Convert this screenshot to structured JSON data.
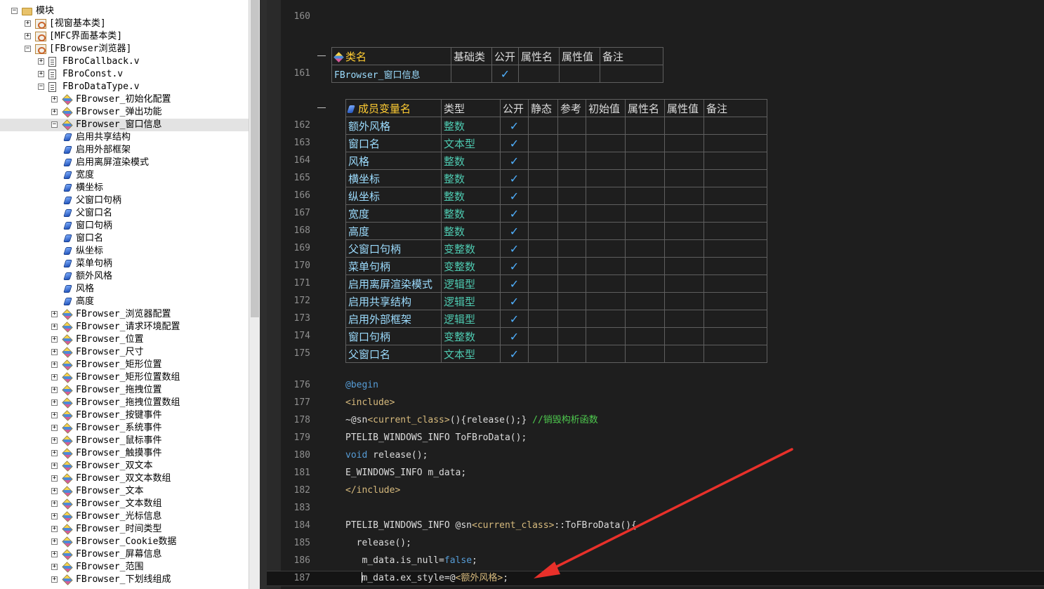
{
  "tree": {
    "items": [
      {
        "level": 0,
        "toggle": "−",
        "icon": "folder-icon",
        "label": "模块"
      },
      {
        "level": 1,
        "toggle": "+",
        "icon": "module-icon",
        "label": "[视窗基本类]"
      },
      {
        "level": 1,
        "toggle": "+",
        "icon": "module-icon",
        "label": "[MFC界面基本类]"
      },
      {
        "level": 1,
        "toggle": "−",
        "icon": "module-icon",
        "label": "[FBrowser浏览器]"
      },
      {
        "level": 2,
        "toggle": "+",
        "icon": "file-icon",
        "label": "FBroCallback.v"
      },
      {
        "level": 2,
        "toggle": "+",
        "icon": "file-icon",
        "label": "FBroConst.v"
      },
      {
        "level": 2,
        "toggle": "−",
        "icon": "file-icon",
        "label": "FBroDataType.v"
      },
      {
        "level": 3,
        "toggle": "+",
        "icon": "class-icon",
        "label": "FBrowser_初始化配置"
      },
      {
        "level": 3,
        "toggle": "+",
        "icon": "class-icon",
        "label": "FBrowser_弹出功能"
      },
      {
        "level": 3,
        "toggle": "−",
        "icon": "class-icon",
        "label": "FBrowser_窗口信息",
        "selected": true
      },
      {
        "level": 4,
        "toggle": "",
        "icon": "member-icon",
        "label": "启用共享结构"
      },
      {
        "level": 4,
        "toggle": "",
        "icon": "member-icon",
        "label": "启用外部框架"
      },
      {
        "level": 4,
        "toggle": "",
        "icon": "member-icon",
        "label": "启用离屏渲染模式"
      },
      {
        "level": 4,
        "toggle": "",
        "icon": "member-icon",
        "label": "宽度"
      },
      {
        "level": 4,
        "toggle": "",
        "icon": "member-icon",
        "label": "横坐标"
      },
      {
        "level": 4,
        "toggle": "",
        "icon": "member-icon",
        "label": "父窗口句柄"
      },
      {
        "level": 4,
        "toggle": "",
        "icon": "member-icon",
        "label": "父窗口名"
      },
      {
        "level": 4,
        "toggle": "",
        "icon": "member-icon",
        "label": "窗口句柄"
      },
      {
        "level": 4,
        "toggle": "",
        "icon": "member-icon",
        "label": "窗口名"
      },
      {
        "level": 4,
        "toggle": "",
        "icon": "member-icon",
        "label": "纵坐标"
      },
      {
        "level": 4,
        "toggle": "",
        "icon": "member-icon",
        "label": "菜单句柄"
      },
      {
        "level": 4,
        "toggle": "",
        "icon": "member-icon",
        "label": "额外风格"
      },
      {
        "level": 4,
        "toggle": "",
        "icon": "member-icon",
        "label": "风格"
      },
      {
        "level": 4,
        "toggle": "",
        "icon": "member-icon",
        "label": "高度"
      },
      {
        "level": 3,
        "toggle": "+",
        "icon": "class-icon",
        "label": "FBrowser_浏览器配置"
      },
      {
        "level": 3,
        "toggle": "+",
        "icon": "class-icon",
        "label": "FBrowser_请求环境配置"
      },
      {
        "level": 3,
        "toggle": "+",
        "icon": "class-icon",
        "label": "FBrowser_位置"
      },
      {
        "level": 3,
        "toggle": "+",
        "icon": "class-icon",
        "label": "FBrowser_尺寸"
      },
      {
        "level": 3,
        "toggle": "+",
        "icon": "class-icon",
        "label": "FBrowser_矩形位置"
      },
      {
        "level": 3,
        "toggle": "+",
        "icon": "class-icon",
        "label": "FBrowser_矩形位置数组"
      },
      {
        "level": 3,
        "toggle": "+",
        "icon": "class-icon",
        "label": "FBrowser_拖拽位置"
      },
      {
        "level": 3,
        "toggle": "+",
        "icon": "class-icon",
        "label": "FBrowser_拖拽位置数组"
      },
      {
        "level": 3,
        "toggle": "+",
        "icon": "class-icon",
        "label": "FBrowser_按键事件"
      },
      {
        "level": 3,
        "toggle": "+",
        "icon": "class-icon",
        "label": "FBrowser_系统事件"
      },
      {
        "level": 3,
        "toggle": "+",
        "icon": "class-icon",
        "label": "FBrowser_鼠标事件"
      },
      {
        "level": 3,
        "toggle": "+",
        "icon": "class-icon",
        "label": "FBrowser_触摸事件"
      },
      {
        "level": 3,
        "toggle": "+",
        "icon": "class-icon",
        "label": "FBrowser_双文本"
      },
      {
        "level": 3,
        "toggle": "+",
        "icon": "class-icon",
        "label": "FBrowser_双文本数组"
      },
      {
        "level": 3,
        "toggle": "+",
        "icon": "class-icon",
        "label": "FBrowser_文本"
      },
      {
        "level": 3,
        "toggle": "+",
        "icon": "class-icon",
        "label": "FBrowser_文本数组"
      },
      {
        "level": 3,
        "toggle": "+",
        "icon": "class-icon",
        "label": "FBrowser_光标信息"
      },
      {
        "level": 3,
        "toggle": "+",
        "icon": "class-icon",
        "label": "FBrowser_时间类型"
      },
      {
        "level": 3,
        "toggle": "+",
        "icon": "class-icon",
        "label": "FBrowser_Cookie数据"
      },
      {
        "level": 3,
        "toggle": "+",
        "icon": "class-icon",
        "label": "FBrowser_屏幕信息"
      },
      {
        "level": 3,
        "toggle": "+",
        "icon": "class-icon",
        "label": "FBrowser_范围"
      },
      {
        "level": 3,
        "toggle": "+",
        "icon": "class-icon",
        "label": "FBrowser_下划线组成"
      }
    ]
  },
  "editor": {
    "top_lines": [
      {
        "num": "160",
        "code": ""
      }
    ],
    "class_table": {
      "line": "161",
      "headers": [
        "类名",
        "基础类",
        "公开",
        "属性名",
        "属性值",
        "备注"
      ],
      "row": {
        "name": "FBrowser_窗口信息",
        "base": "",
        "public": "✓",
        "attr_name": "",
        "attr_value": "",
        "remark": ""
      }
    },
    "member_table": {
      "headers": [
        "成员变量名",
        "类型",
        "公开",
        "静态",
        "参考",
        "初始值",
        "属性名",
        "属性值",
        "备注"
      ],
      "rows": [
        {
          "line": "162",
          "name": "额外风格",
          "type": "整数",
          "public": "✓"
        },
        {
          "line": "163",
          "name": "窗口名",
          "type": "文本型",
          "public": "✓"
        },
        {
          "line": "164",
          "name": "风格",
          "type": "整数",
          "public": "✓"
        },
        {
          "line": "165",
          "name": "横坐标",
          "type": "整数",
          "public": "✓"
        },
        {
          "line": "166",
          "name": "纵坐标",
          "type": "整数",
          "public": "✓"
        },
        {
          "line": "167",
          "name": "宽度",
          "type": "整数",
          "public": "✓"
        },
        {
          "line": "168",
          "name": "高度",
          "type": "整数",
          "public": "✓"
        },
        {
          "line": "169",
          "name": "父窗口句柄",
          "type": "变整数",
          "public": "✓"
        },
        {
          "line": "170",
          "name": "菜单句柄",
          "type": "变整数",
          "public": "✓"
        },
        {
          "line": "171",
          "name": "启用离屏渲染模式",
          "type": "逻辑型",
          "public": "✓"
        },
        {
          "line": "172",
          "name": "启用共享结构",
          "type": "逻辑型",
          "public": "✓"
        },
        {
          "line": "173",
          "name": "启用外部框架",
          "type": "逻辑型",
          "public": "✓"
        },
        {
          "line": "174",
          "name": "窗口句柄",
          "type": "变整数",
          "public": "✓"
        },
        {
          "line": "175",
          "name": "父窗口名",
          "type": "文本型",
          "public": "✓"
        }
      ]
    },
    "code_lines": [
      {
        "num": "176",
        "parts": [
          {
            "t": "@begin",
            "c": "kw"
          }
        ]
      },
      {
        "num": "177",
        "parts": [
          {
            "t": "<include>",
            "c": "cn"
          }
        ]
      },
      {
        "num": "178",
        "parts": [
          {
            "t": "~@sn",
            "c": "txt"
          },
          {
            "t": "<current_class>",
            "c": "cn"
          },
          {
            "t": "(){release();} ",
            "c": "txt"
          },
          {
            "t": "//销毁构析函数",
            "c": "cm"
          }
        ]
      },
      {
        "num": "179",
        "parts": [
          {
            "t": "PTELIB_WINDOWS_INFO ToFBroData();",
            "c": "txt"
          }
        ]
      },
      {
        "num": "180",
        "parts": [
          {
            "t": "void",
            "c": "kw"
          },
          {
            "t": " release();",
            "c": "txt"
          }
        ]
      },
      {
        "num": "181",
        "parts": [
          {
            "t": "E_WINDOWS_INFO m_data;",
            "c": "txt"
          }
        ]
      },
      {
        "num": "182",
        "parts": [
          {
            "t": "</include>",
            "c": "cn"
          }
        ]
      },
      {
        "num": "183",
        "parts": []
      },
      {
        "num": "184",
        "parts": [
          {
            "t": "PTELIB_WINDOWS_INFO @sn",
            "c": "txt"
          },
          {
            "t": "<current_class>",
            "c": "cn"
          },
          {
            "t": "::ToFBroData(){",
            "c": "txt"
          }
        ]
      },
      {
        "num": "185",
        "parts": [
          {
            "t": "  release();",
            "c": "txt"
          }
        ]
      },
      {
        "num": "186",
        "parts": [
          {
            "t": "   m_data.is_null=",
            "c": "txt"
          },
          {
            "t": "false",
            "c": "kw"
          },
          {
            "t": ";",
            "c": "txt"
          }
        ]
      },
      {
        "num": "187",
        "parts": [
          {
            "t": "   m_data.ex_style=@",
            "c": "txt"
          },
          {
            "t": "<额外风格>",
            "c": "cn"
          },
          {
            "t": ";",
            "c": "txt"
          }
        ]
      }
    ]
  },
  "colors": {
    "editor_bg": "#1e1e1e",
    "keyword": "#569cd6",
    "comment": "#4ec94e",
    "type": "#4ec9b0",
    "check": "#4fb0ff",
    "arrow": "#e8302a"
  }
}
